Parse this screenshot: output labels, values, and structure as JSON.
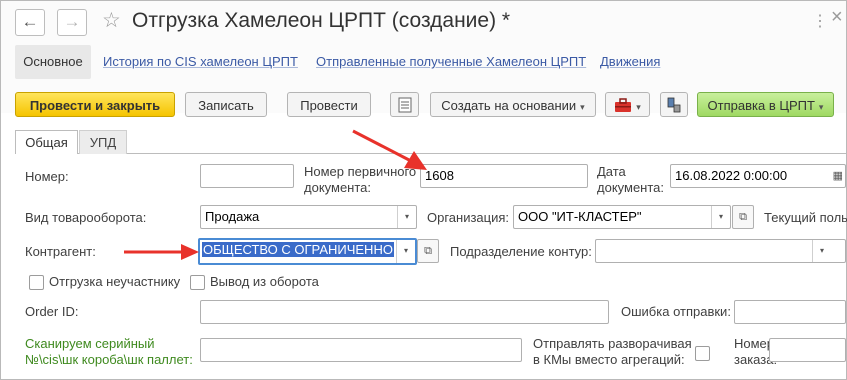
{
  "window": {
    "title": "Отгрузка Хамелеон ЦРПТ (создание) *",
    "back_icon": "←",
    "forward_icon": "→",
    "favorite_icon": "☆",
    "more_icon": "⋮",
    "close_icon": "×"
  },
  "section_tabs": [
    {
      "label": "Основное"
    },
    {
      "label": "История по CIS хамелеон ЦРПТ"
    },
    {
      "label": "Отправленные полученные Хамелеон ЦРПТ"
    },
    {
      "label": "Движения"
    }
  ],
  "toolbar": {
    "post_close": "Провести и закрыть",
    "save": "Записать",
    "post": "Провести",
    "create_based": "Создать на основании",
    "send_crpt": "Отправка в ЦРПТ",
    "dropdown_glyph": "▾"
  },
  "form_tabs": [
    {
      "label": "Общая"
    },
    {
      "label": "УПД"
    }
  ],
  "form": {
    "number_label": "Номер:",
    "number_value": "",
    "primary_doc_label_1": "Номер первичного",
    "primary_doc_label_2": "документа:",
    "primary_doc_value": "1608",
    "doc_date_label_1": "Дата",
    "doc_date_label_2": "документа:",
    "doc_date_value": "16.08.2022  0:00:00",
    "turnover_label": "Вид товарооборота:",
    "turnover_value": "Продажа",
    "org_label": "Организация:",
    "org_value": "ООО \"ИТ-КЛАСТЕР\"",
    "current_user_label": "Текущий поль",
    "counterparty_label": "Контрагент:",
    "counterparty_value": "ОБЩЕСТВО С ОГРАНИЧЕННО",
    "division_label": "Подразделение контур:",
    "division_value": "",
    "shipment_nonparticipant_label": "Отгрузка неучастнику",
    "withdrawal_label": "Вывод из оборота",
    "order_id_label": "Order ID:",
    "order_id_value": "",
    "send_error_label": "Ошибка отправки:",
    "scan_label_1": "Сканируем серийный",
    "scan_label_2": "№\\cis\\шк короба\\шк паллет:",
    "unpack_label_1": "Отправлять разворачивая",
    "unpack_label_2": "в КМы вместо агрегаций:",
    "order_no_label_1": "Номер",
    "order_no_label_2": "заказа:"
  },
  "colors": {
    "accent_yellow": "#f5c400",
    "accent_green": "#9fd962",
    "link_blue": "#3b5aa5",
    "annotation_red": "#e8322b",
    "focus_blue": "#4a8bd4"
  }
}
